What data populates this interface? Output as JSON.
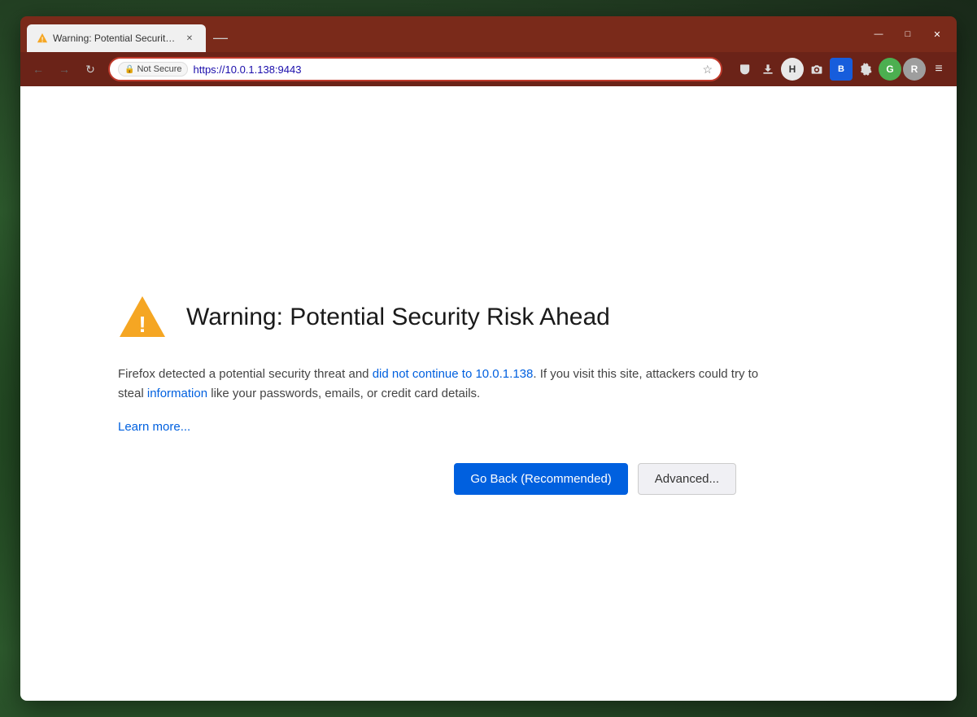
{
  "browser": {
    "tab": {
      "title": "Warning: Potential Security Risk",
      "favicon_label": "warning-icon"
    },
    "window_controls": {
      "minimize": "—",
      "maximize": "□",
      "close": "✕"
    },
    "nav": {
      "back_label": "←",
      "forward_label": "→",
      "refresh_label": "↻"
    },
    "address_bar": {
      "not_secure_label": "Not Secure",
      "url": "https://10.0.1.138:9443",
      "star_label": "☆"
    },
    "toolbar": {
      "pocket_label": "🏷",
      "download_label": "⬇",
      "h_label": "H",
      "camera_label": "📷",
      "bitwarden_label": "B",
      "settings_label": "⚙",
      "g_label": "G",
      "r_label": "R",
      "menu_label": "≡"
    }
  },
  "page": {
    "warning_title": "Warning: Potential Security Risk Ahead",
    "description_part1": "Firefox detected a potential security threat and did not continue to 10.0.1.138. If you visit this site, attackers could try to steal information like your passwords, emails, or credit card details.",
    "learn_more_label": "Learn more...",
    "go_back_label": "Go Back (Recommended)",
    "advanced_label": "Advanced..."
  },
  "colors": {
    "title_bar_bg": "#7a2a1a",
    "nav_bar_bg": "#6b2318",
    "address_border": "#c0392b",
    "go_back_bg": "#0060df",
    "warning_orange": "#f5a623"
  }
}
